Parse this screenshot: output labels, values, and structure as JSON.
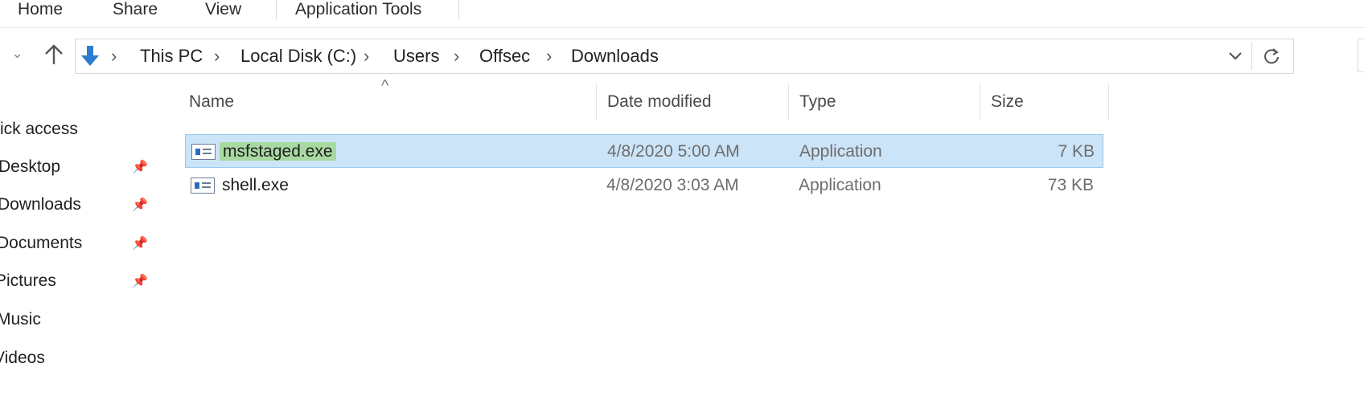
{
  "ribbon": {
    "tabs": [
      "Home",
      "Share",
      "View",
      "Application Tools"
    ]
  },
  "address_bar": {
    "crumbs": [
      "This PC",
      "Local Disk (C:)",
      "Users",
      "Offsec",
      "Downloads"
    ],
    "icons": [
      "back-arrow-icon",
      "up-arrow-icon",
      "download-arrow-icon",
      "chevron-right-icon",
      "dropdown-chevron-icon",
      "refresh-icon"
    ]
  },
  "sidebar": {
    "items": [
      "ick access",
      "Desktop",
      "Downloads",
      "Documents",
      "Pictures",
      "Music",
      "Videos"
    ]
  },
  "columns": {
    "name": "Name",
    "date_modified": "Date modified",
    "type": "Type",
    "size": "Size",
    "sort_indicator": "^"
  },
  "files": [
    {
      "name": "msfstaged.exe",
      "date": "4/8/2020 5:00 AM",
      "type": "Application",
      "size": "7 KB",
      "selected": true
    },
    {
      "name": "shell.exe",
      "date": "4/8/2020 3:03 AM",
      "type": "Application",
      "size": "73 KB",
      "selected": false
    }
  ],
  "colors": {
    "selection": "#cce4f7",
    "rename_highlight": "#a8d9a2",
    "accent": "#2c6bbf"
  }
}
